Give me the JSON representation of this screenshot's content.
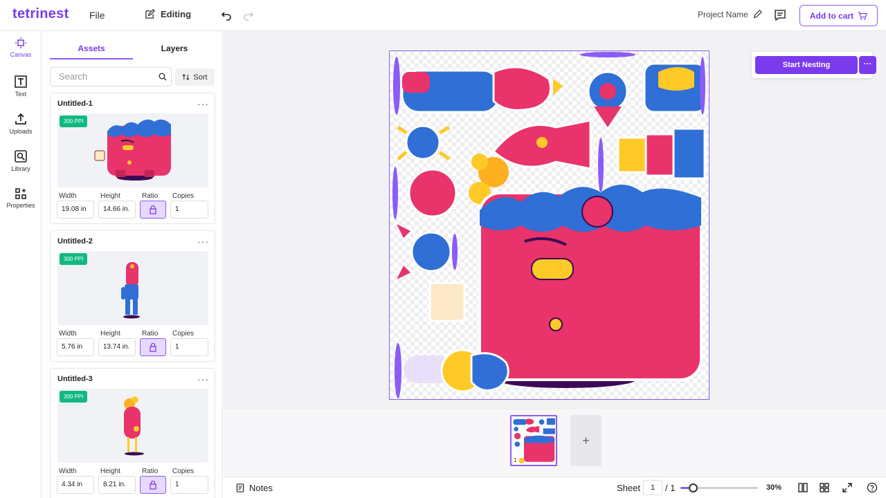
{
  "app": {
    "logo": "tetrinest",
    "file_menu": "File",
    "mode": "Editing",
    "project_name": "Project Name",
    "add_to_cart": "Add to cart",
    "brand_color": "#7c3aed"
  },
  "rail": {
    "items": [
      {
        "label": "Canvas",
        "icon": "canvas-icon",
        "active": true
      },
      {
        "label": "Text",
        "icon": "text-icon"
      },
      {
        "label": "Uploads",
        "icon": "upload-icon"
      },
      {
        "label": "Library",
        "icon": "library-icon"
      },
      {
        "label": "Properties",
        "icon": "properties-icon"
      }
    ]
  },
  "panel": {
    "tabs": [
      "Assets",
      "Layers"
    ],
    "search_placeholder": "Search",
    "sort_label": "Sort",
    "field_labels": {
      "width": "Width",
      "height": "Height",
      "ratio": "Ratio",
      "copies": "Copies"
    },
    "assets": [
      {
        "name": "Untitled-1",
        "ppi": "300 PPI",
        "width": "19.08 in",
        "height": "14.66 in.",
        "copies": "1"
      },
      {
        "name": "Untitled-2",
        "ppi": "300 PPI",
        "width": "5.76 in",
        "height": "13.74 in.",
        "copies": "1"
      },
      {
        "name": "Untitled-3",
        "ppi": "300 PPI",
        "width": "4.34 in",
        "height": "8.21 in.",
        "copies": "1"
      }
    ]
  },
  "workspace": {
    "start_nesting": "Start Nesting",
    "more": "···",
    "thumb_number": "1",
    "add_sheet": "+"
  },
  "bottombar": {
    "notes": "Notes",
    "sheet_label": "Sheet",
    "sheet_current": "1",
    "sheet_total": "/ 1",
    "zoom": "30%",
    "zoom_fraction": 0.3
  }
}
